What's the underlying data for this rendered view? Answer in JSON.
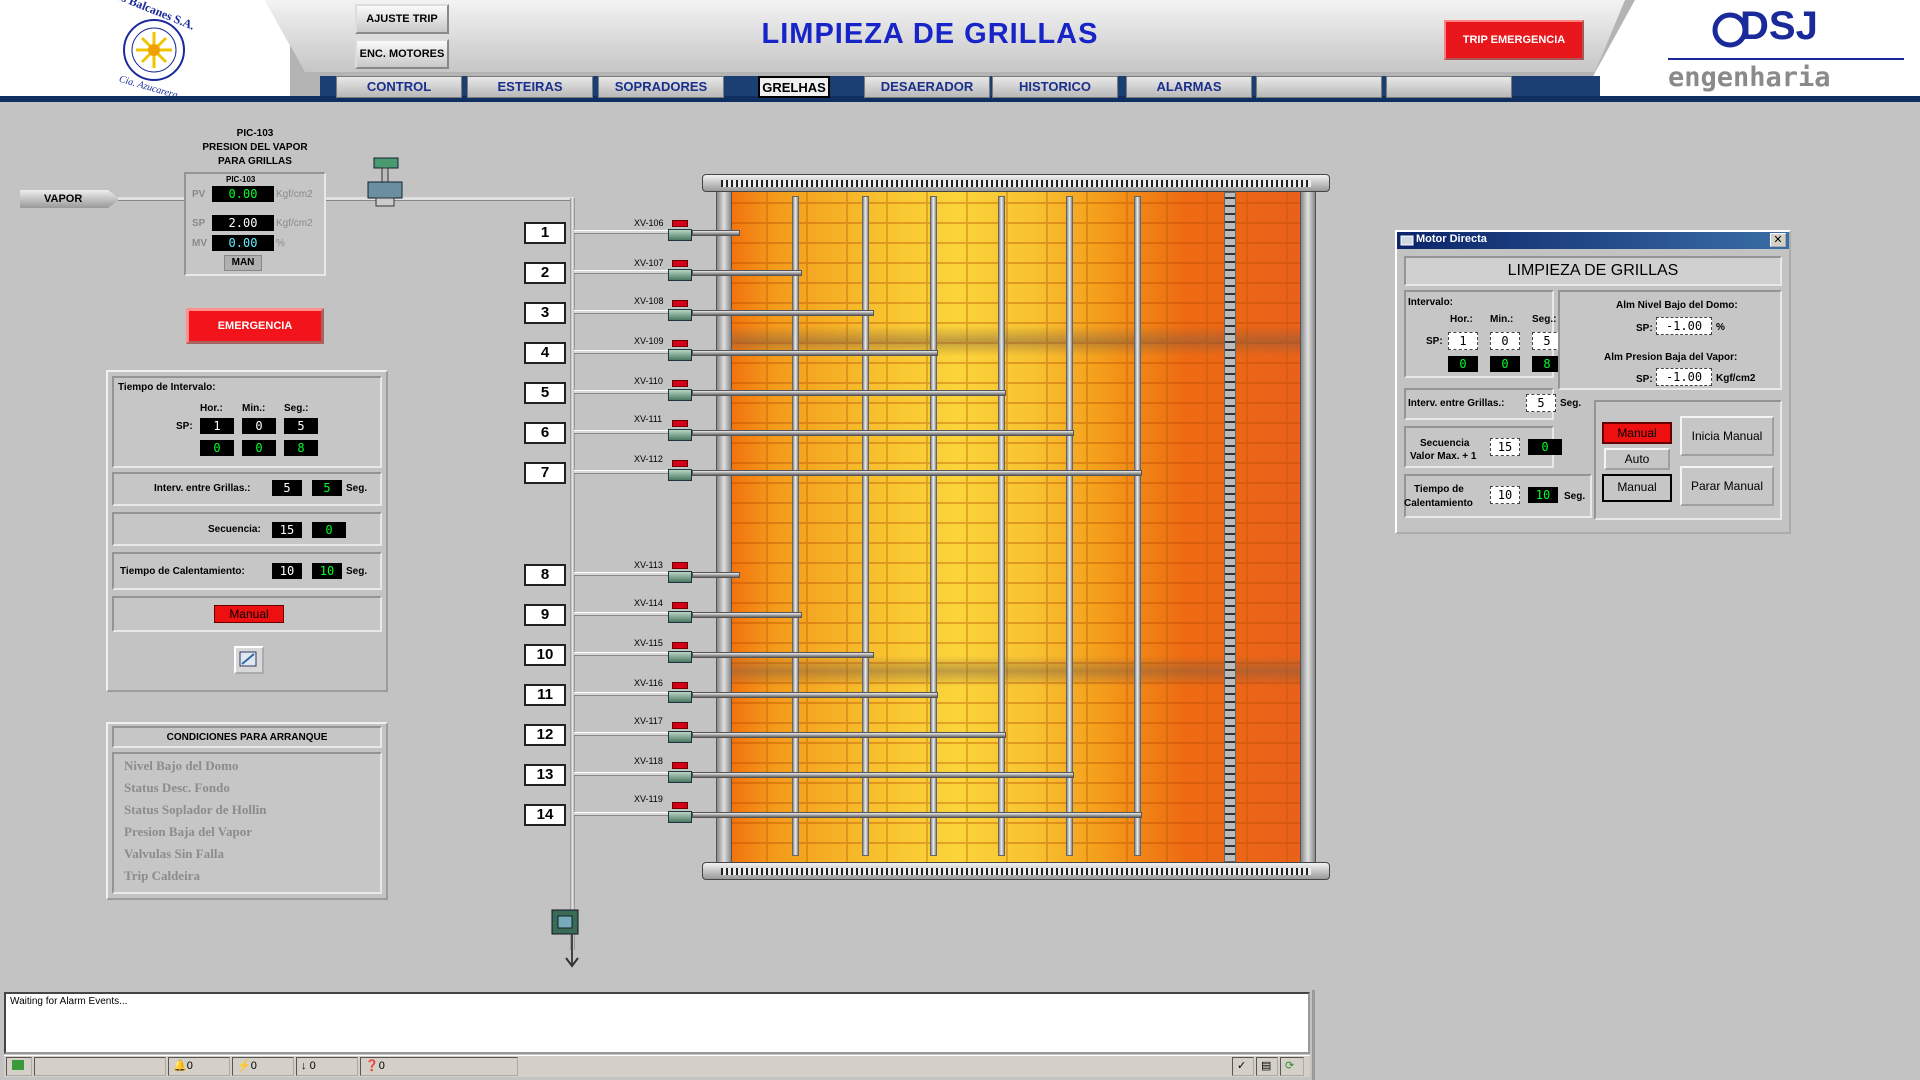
{
  "header": {
    "title": "LIMPIEZA DE GRILLAS",
    "buttons": {
      "ajuste_trip": "AJUSTE TRIP",
      "enc_motores": "ENC. MOTORES",
      "trip_emergencia": "TRIP EMERGENCIA"
    },
    "tabs": [
      {
        "label": "CONTROL"
      },
      {
        "label": "ESTEIRAS"
      },
      {
        "label": "SOPRADORES"
      },
      {
        "label": "GRELHAS"
      },
      {
        "label": "DESAERADOR"
      },
      {
        "label": "HISTORICO"
      },
      {
        "label": "ALARMAS"
      },
      {
        "label": ""
      },
      {
        "label": ""
      }
    ],
    "active_tab": "GRELHAS",
    "logo_left": {
      "name": "Los Balcanes S.A.",
      "sub": "Cia. Azucarera"
    },
    "logo_right": {
      "brand": "DSJ",
      "sub": "engenharia"
    }
  },
  "pic": {
    "title1": "PIC-103",
    "title2": "PRESION DEL VAPOR",
    "title3": "PARA GRILLAS",
    "tag": "PIC-103",
    "vapor_label": "VAPOR",
    "pv_label": "PV",
    "pv": "0.00",
    "pv_unit": "Kgf/cm2",
    "sp_label": "SP",
    "sp": "2.00",
    "sp_unit": "Kgf/cm2",
    "mv_label": "MV",
    "mv": "0.00",
    "mv_unit": "%",
    "mode": "MAN"
  },
  "emergencia": "EMERGENCIA",
  "interval_panel": {
    "title": "Tiempo de Intervalo:",
    "hor": "Hor.:",
    "min": "Min.:",
    "seg": "Seg.:",
    "sp_label": "SP:",
    "sp": [
      "1",
      "0",
      "5"
    ],
    "pv": [
      "0",
      "0",
      "8"
    ],
    "interv_label": "Interv. entre Grillas.:",
    "interv_sp": "5",
    "interv_pv": "5",
    "interv_unit": "Seg.",
    "sec_label": "Secuencia:",
    "sec_sp": "15",
    "sec_pv": "0",
    "calent_label": "Tiempo de Calentamiento:",
    "calent_sp": "10",
    "calent_pv": "10",
    "calent_unit": "Seg.",
    "mode": "Manual"
  },
  "conditions": {
    "title": "CONDICIONES PARA  ARRANQUE",
    "items": [
      "Nivel Bajo del Domo",
      "Status Desc. Fondo",
      "Status Soplador de Hollin",
      "Presion Baja del Vapor",
      "Valvulas Sin Falla",
      "Trip Caldeira"
    ]
  },
  "valves": [
    {
      "num": "1",
      "tag": "XV-106"
    },
    {
      "num": "2",
      "tag": "XV-107"
    },
    {
      "num": "3",
      "tag": "XV-108"
    },
    {
      "num": "4",
      "tag": "XV-109"
    },
    {
      "num": "5",
      "tag": "XV-110"
    },
    {
      "num": "6",
      "tag": "XV-111"
    },
    {
      "num": "7",
      "tag": "XV-112"
    },
    {
      "num": "8",
      "tag": "XV-113"
    },
    {
      "num": "9",
      "tag": "XV-114"
    },
    {
      "num": "10",
      "tag": "XV-115"
    },
    {
      "num": "11",
      "tag": "XV-116"
    },
    {
      "num": "12",
      "tag": "XV-117"
    },
    {
      "num": "13",
      "tag": "XV-118"
    },
    {
      "num": "14",
      "tag": "XV-119"
    }
  ],
  "motor_window": {
    "titlebar": "Motor Directa",
    "heading": "LIMPIEZA DE GRILLAS",
    "intervalo": "Intervalo:",
    "hor": "Hor.:",
    "min": "Min.:",
    "seg": "Seg.:",
    "sp_label": "SP:",
    "sp": [
      "1",
      "0",
      "5"
    ],
    "pv": [
      "0",
      "0",
      "8"
    ],
    "alm_nivel": "Alm Nivel Bajo del Domo:",
    "alm_nivel_sp": "-1.00",
    "alm_nivel_unit": "%",
    "alm_presion": "Alm Presion Baja del Vapor:",
    "alm_presion_sp": "-1.00",
    "alm_presion_unit": "Kgf/cm2",
    "interv_label": "Interv. entre Grillas.:",
    "interv_sp": "5",
    "interv_unit": "Seg.",
    "sec_label1": "Secuencia",
    "sec_label2": "Valor Max. + 1",
    "sec_sp": "15",
    "sec_pv": "0",
    "calent_label1": "Tiempo de",
    "calent_label2": "Calentamiento",
    "calent_sp": "10",
    "calent_pv": "10",
    "calent_unit": "Seg.",
    "mode_indicator": "Manual",
    "btn_auto": "Auto",
    "btn_manual": "Manual",
    "btn_inicia": "Inicia Manual",
    "btn_parar": "Parar Manual"
  },
  "alarm": {
    "message": "Waiting for Alarm Events..."
  },
  "statusbar": {
    "c1": "0",
    "c2": "0",
    "c3": "0",
    "c4": "0"
  }
}
